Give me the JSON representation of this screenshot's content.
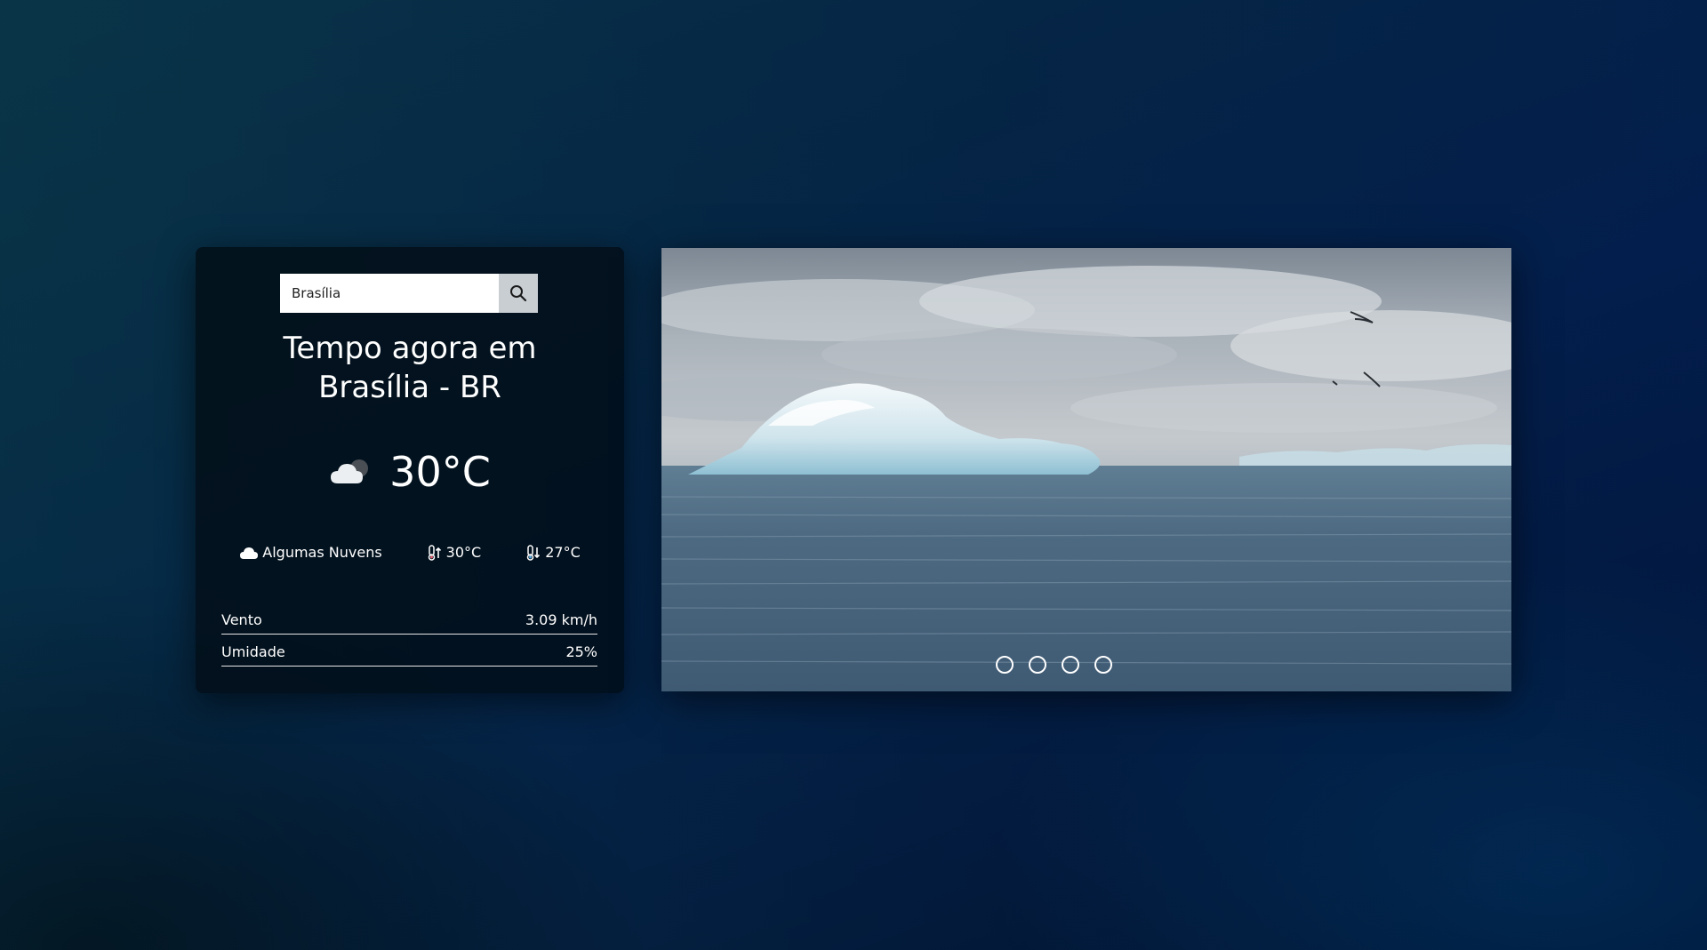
{
  "search": {
    "value": "Brasília",
    "placeholder": "",
    "button_icon": "search-icon"
  },
  "weather": {
    "title_line1": "Tempo agora em",
    "title_line2": "Brasília - BR",
    "icon": "cloud-icon",
    "temperature": "30°C",
    "description_icon": "cloud-icon",
    "description": "Algumas Nuvens",
    "max_icon": "thermometer-up-icon",
    "max_temp": "30°C",
    "min_icon": "thermometer-down-icon",
    "min_temp": "27°C"
  },
  "stats": [
    {
      "label": "Vento",
      "value": "3.09 km/h"
    },
    {
      "label": "Umidade",
      "value": "25%"
    }
  ],
  "carousel": {
    "slide_count": 4,
    "image_subject": "iceberg floating on the ocean under a cloudy sky"
  },
  "colors": {
    "card_background": "#020e16",
    "search_button": "#c9ced3",
    "text": "#ffffff"
  }
}
